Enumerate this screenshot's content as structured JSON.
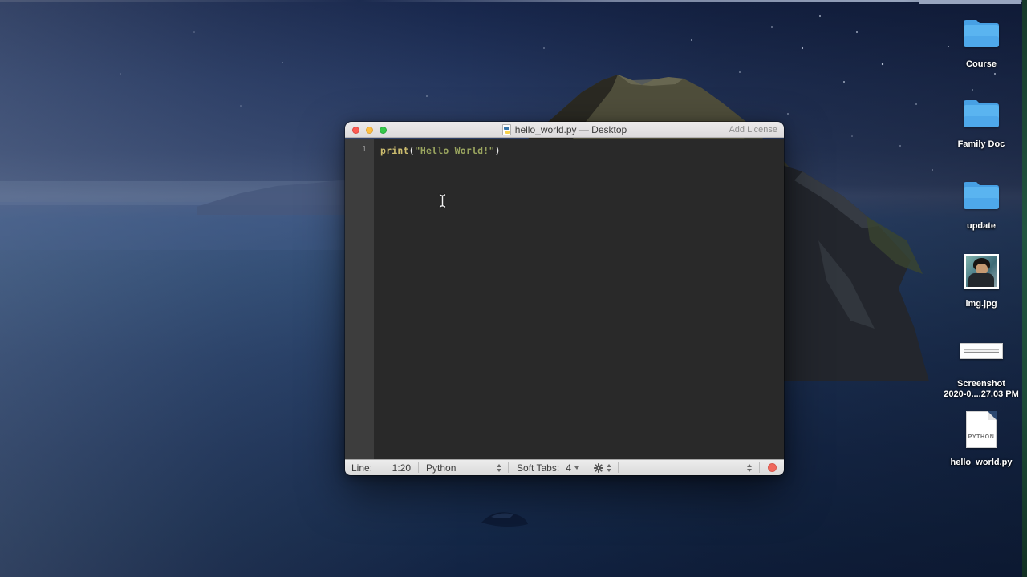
{
  "desktop": {
    "icons": [
      {
        "name": "course",
        "type": "folder",
        "label": "Course"
      },
      {
        "name": "family-doc",
        "type": "folder",
        "label": "Family Doc"
      },
      {
        "name": "update",
        "type": "folder",
        "label": "update"
      },
      {
        "name": "img-jpg",
        "type": "image",
        "label": "img.jpg"
      },
      {
        "name": "screenshot",
        "type": "screenshot",
        "label_line1": "Screenshot",
        "label_line2": "2020-0....27.03 PM"
      },
      {
        "name": "hello-world-py",
        "type": "python-file",
        "label": "hello_world.py",
        "badge": "PYTHON"
      }
    ],
    "folder_color": "#5ab4f0",
    "label_color": "#ffffff"
  },
  "window": {
    "title": "hello_world.py — Desktop",
    "header_action": "Add License",
    "traffic_lights": {
      "close": "#fc5a52",
      "minimize": "#fdbe41",
      "zoom": "#35c84a"
    },
    "editor": {
      "line_number": "1",
      "code": {
        "keyword": "print",
        "open_paren": "(",
        "string": "\"Hello World!\"",
        "close_paren": ")"
      },
      "colors": {
        "background": "#292929",
        "gutter": "#3d3d3d",
        "keyword": "#cdbd6e",
        "string": "#9aa55f",
        "paren": "#e8e8e8",
        "line_number": "#919191"
      }
    },
    "status_bar": {
      "line_label": "Line:",
      "line_value": "1:20",
      "language": "Python",
      "soft_tabs_label": "Soft Tabs:",
      "soft_tabs_value": "4",
      "record_color": "#f0685d"
    }
  }
}
